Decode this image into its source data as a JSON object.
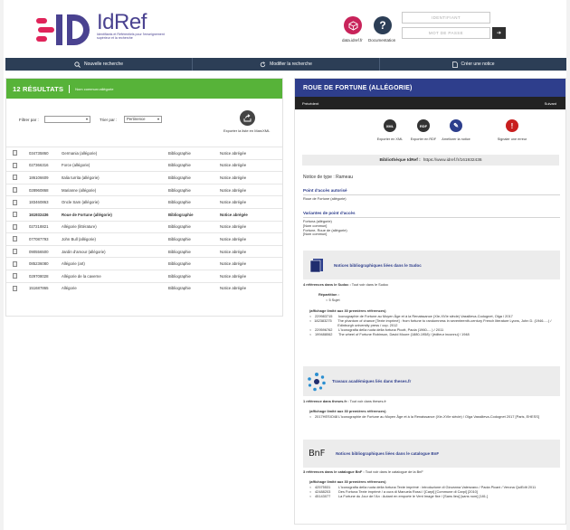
{
  "header": {
    "logo_text": "IdRef",
    "logo_subtitle": "Identifiants et Référentiels pour l'enseignement supérieur et la recherche",
    "data_label": "data.idref.fr",
    "doc_label": "Documentation",
    "login_placeholder": "IDENTIFIANT",
    "password_placeholder": "MOT DE PASSE",
    "login_button_glyph": "➔"
  },
  "nav": {
    "items": [
      {
        "label": "Nouvelle recherche",
        "icon": "search-icon"
      },
      {
        "label": "Modifier la recherche",
        "icon": "refresh-icon"
      },
      {
        "label": "Créer une notice",
        "icon": "document-icon"
      }
    ]
  },
  "results": {
    "count_label": "12 RÉSULTATS",
    "filter_text": "Nom commun=allégorie",
    "filter_by": "Filtrer par :",
    "filter_value": "",
    "sort_by": "Trier par :",
    "sort_value": "Pertinence",
    "export_label": "Exporter la liste en MarcXML",
    "rows": [
      {
        "id": "034735860",
        "name": "Germania (allégorie)",
        "type": "Bibliographie",
        "status": "Notice abrégée",
        "bold": false
      },
      {
        "id": "027366316",
        "name": "Force (allégorie)",
        "type": "Bibliographie",
        "status": "Notice abrégée",
        "bold": false
      },
      {
        "id": "186106609",
        "name": "Italia turrita (allégorie)",
        "type": "Bibliographie",
        "status": "Notice abrégée",
        "bold": false
      },
      {
        "id": "028960868",
        "name": "Marianne (allégorie)",
        "type": "Bibliographie",
        "status": "Notice abrégée",
        "bold": false
      },
      {
        "id": "183460863",
        "name": "Oncle Sam (allégorie)",
        "type": "Bibliographie",
        "status": "Notice abrégée",
        "bold": false
      },
      {
        "id": "161932436",
        "name": "Roue de Fortune (allégorie)",
        "type": "Bibliographie",
        "status": "Notice abrégée",
        "bold": true
      },
      {
        "id": "027218821",
        "name": "Allégorie (littérature)",
        "type": "Bibliographie",
        "status": "Notice abrégée",
        "bold": false
      },
      {
        "id": "077087793",
        "name": "John Bull (allégorie)",
        "type": "Bibliographie",
        "status": "Notice abrégée",
        "bold": false
      },
      {
        "id": "090556500",
        "name": "Jardin d'amour (allégorie)",
        "type": "Bibliographie",
        "status": "Notice abrégée",
        "bold": false
      },
      {
        "id": "085236080",
        "name": "Allégorie (art)",
        "type": "Bibliographie",
        "status": "Notice abrégée",
        "bold": false
      },
      {
        "id": "029708028",
        "name": "Allégorie de la caverne",
        "type": "Bibliographie",
        "status": "Notice abrégée",
        "bold": false
      },
      {
        "id": "151687865",
        "name": "Allégorie",
        "type": "Bibliographie",
        "status": "Notice abrégée",
        "bold": false
      }
    ]
  },
  "record": {
    "title": "ROUE DE FORTUNE (ALLÉGORIE)",
    "prev": "Précédent",
    "next": "Suivant",
    "actions": [
      {
        "label": "Exporter en XML",
        "icon_text": "XML",
        "color": "#333333",
        "icon": "xml-export-icon"
      },
      {
        "label": "Exporter en RDF",
        "icon_text": "RDF",
        "color": "#333333",
        "icon": "rdf-export-icon"
      },
      {
        "label": "Améliorer la notice",
        "icon_text": "✎",
        "color": "#2c3e8c",
        "icon": "edit-wand-icon"
      },
      {
        "label": "Signaler une erreur",
        "icon_text": "!",
        "color": "#c81e1e",
        "icon": "alert-icon"
      }
    ],
    "bib_label": "Bibliothèque IdRef :",
    "bib_url": "https://www.idref.fr/161932436",
    "notice_type": "Notice de type : Rameau",
    "authorized_heading": "Point d'accès autorisé",
    "authorized_value": "Roue de Fortune (allégorie)",
    "variants_heading": "Variantes de point d'accès",
    "variants": [
      "Fortuna (allégorie)",
      "[Nom commun]",
      "Fortune, Roue de (allégorie)",
      "[Nom commun]"
    ],
    "sudoc": {
      "box_title": "Notices bibliographiques liées dans le Sudoc",
      "count_bold": "4 références dans le Sudoc :",
      "count_rest": " Tout voir dans le Sudoc",
      "repartition_label": "Répartition :",
      "repartition_item": "5  Sujet",
      "limit_label": "(affichage limité aux 30 premières références)",
      "items": [
        {
          "id": "229983715",
          "text": "Iconographie de Fortune au Moyen Âge et à la Renaissance (XIe-XVIe siècle) Vassilieva-Codognet, Olga / 2017"
        },
        {
          "id": "182383275",
          "text": "The phantom of chance [Texte imprimé] : from fortune to randomness in seventeenth-century French literature Lyons, John D. (1946-....) / Edinburgh university press / cop. 2012"
        },
        {
          "id": "229596762",
          "text": "L'iconografia della ruota della fortuna Picott, Paola (1960-....) / 2011"
        },
        {
          "id": "199488062",
          "text": "The wheel of Fortune Robinson, David Moore (1880-1958) / [éditeur inconnu] / 1948"
        }
      ]
    },
    "theses": {
      "box_title": "Travaux académiques liés dans theses.fr",
      "count_bold": "1 référence dans theses.fr :",
      "count_rest": " Tout voir dans theses.fr",
      "limit_label": "(affichage limité aux 30 premières références)",
      "items": [
        {
          "id": "2017HESIO48",
          "text": "L'iconographie de Fortune au Moyen Âge et à la Renaissance (XIe-XVIe siècle) / Olga Vassilieva-Codognet  2017  [Paris, EHESS]"
        }
      ]
    },
    "bnf": {
      "logo_text": "BnF",
      "box_title": "Notices bibliographiques liées dans le catalogue BnF",
      "count_bold": "3 références dans le catalogue BnF :",
      "count_rest": " Tout voir dans le catalogue de la BnF",
      "limit_label": "(affichage limité aux 30 premières références)",
      "items": [
        {
          "id": "42575531",
          "text": "L'iconografia della ruota della fortuna Texte imprimé : introduzione di Giovanna Valenzano / Paola Picani / Verona QuiEdit 2011"
        },
        {
          "id": "42488203",
          "text": "Des Fortuna Texte imprimé / a cura di Manuela Rossi / [Carpi] [Commune di Carpi] [2010]"
        },
        {
          "id": "45143077",
          "text": "La Fortune du Jour de l'An : Autant en emporte le Vent Image fixe / [Sans lieu] [sans nom] [181.]"
        }
      ]
    }
  }
}
